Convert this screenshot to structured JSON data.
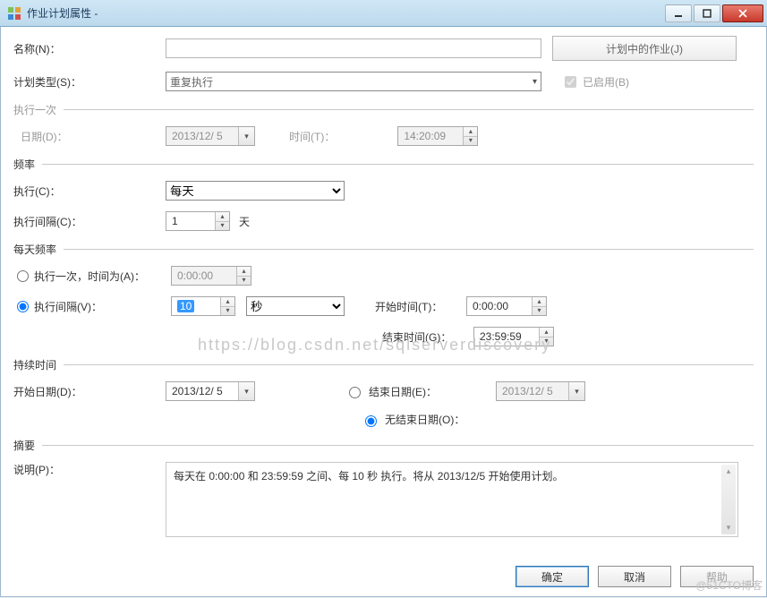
{
  "window": {
    "title": "作业计划属性 -",
    "min_icon": "minimize-icon",
    "max_icon": "maximize-icon",
    "close_icon": "close-icon"
  },
  "top": {
    "name_label": "名称(N)：",
    "name_value": "",
    "jobs_in_schedule_btn": "计划中的作业(J)",
    "schedule_type_label": "计划类型(S)：",
    "schedule_type_value": "重复执行",
    "enabled_label": "已启用(B)",
    "enabled_checked": true
  },
  "once": {
    "section": "执行一次",
    "date_label": "日期(D)：",
    "date_value": "2013/12/ 5",
    "time_label": "时间(T)：",
    "time_value": "14:20:09"
  },
  "freq": {
    "section": "频率",
    "occurs_label": "执行(C)：",
    "occurs_value": "每天",
    "recur_label": "执行间隔(C)：",
    "recur_value": "1",
    "recur_unit": "天"
  },
  "daily": {
    "section": "每天频率",
    "once_label": "执行一次，时间为(A)：",
    "once_value": "0:00:00",
    "every_label": "执行间隔(V)：",
    "every_value": "10",
    "every_unit": "秒",
    "selected": "every",
    "start_label": "开始时间(T)：",
    "start_value": "0:00:00",
    "end_label": "结束时间(G)：",
    "end_value": "23:59:59"
  },
  "duration": {
    "section": "持续时间",
    "start_date_label": "开始日期(D)：",
    "start_date_value": "2013/12/ 5",
    "end_date_label": "结束日期(E)：",
    "end_date_value": "2013/12/ 5",
    "no_end_label": "无结束日期(O)：",
    "selected": "no_end"
  },
  "summary": {
    "section": "摘要",
    "desc_label": "说明(P)：",
    "desc_text": "每天在 0:00:00 和 23:59:59 之间、每 10 秒 执行。将从 2013/12/5 开始使用计划。"
  },
  "footer": {
    "ok": "确定",
    "cancel": "取消",
    "help": "帮助"
  },
  "watermark": "https://blog.csdn.net/sqlserverdiscovery",
  "corner_watermark": "@51CTO博客"
}
